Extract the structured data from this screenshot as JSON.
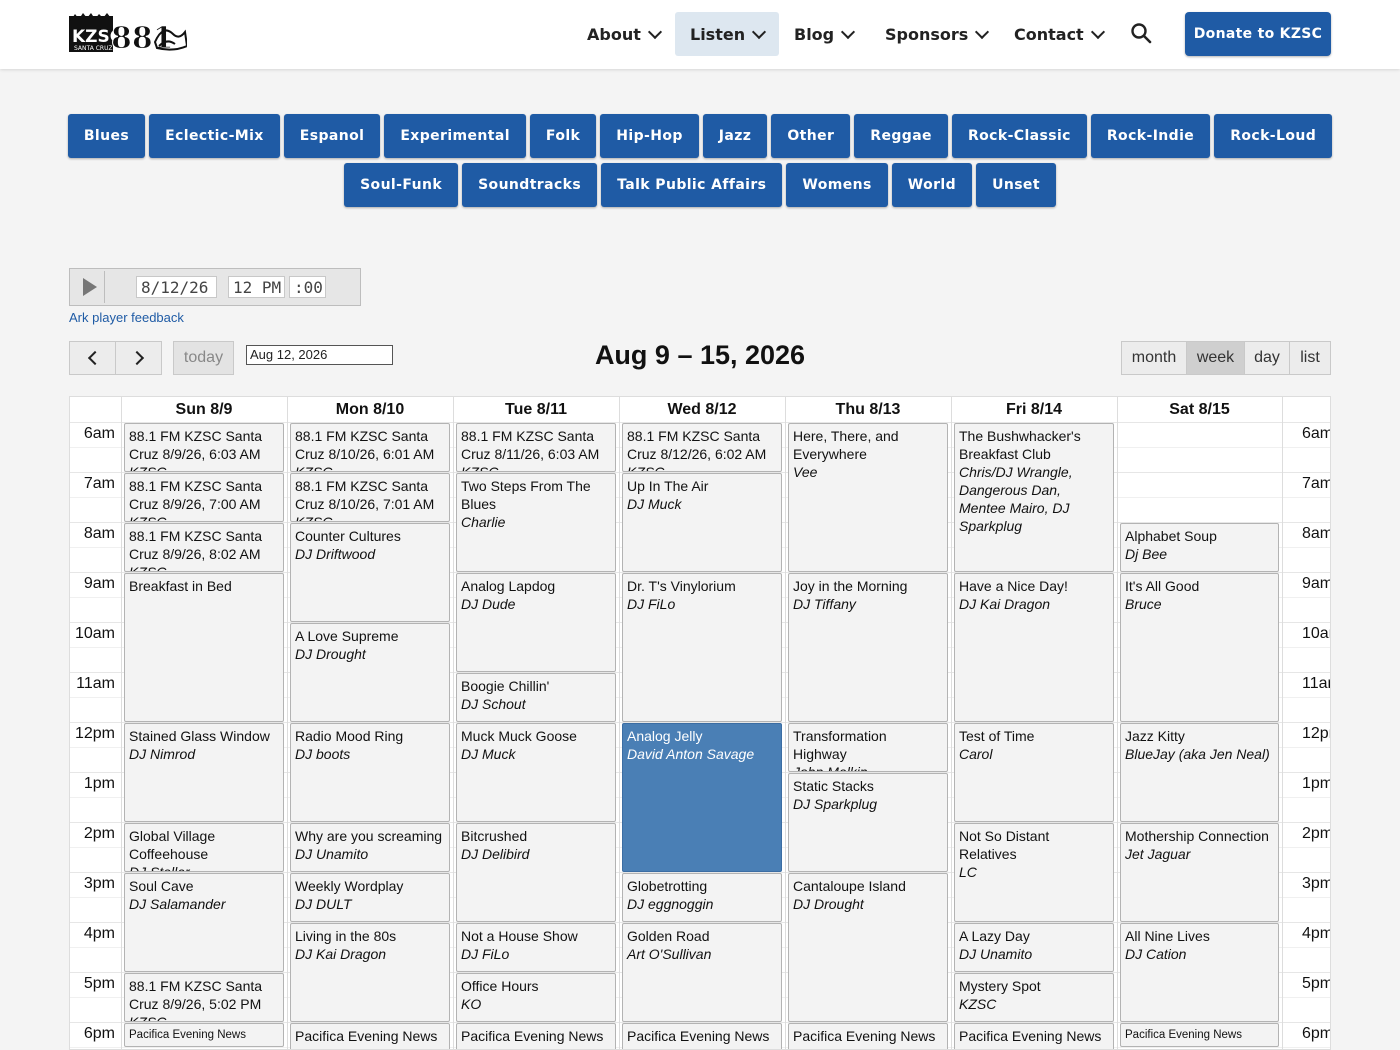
{
  "logo": {
    "alt": "KZSC 88.1 Santa Cruz"
  },
  "nav": {
    "items": [
      "About",
      "Listen",
      "Blog",
      "Sponsors",
      "Contact"
    ],
    "donate": "Donate to KZSC"
  },
  "genres_row1": [
    "Blues",
    "Eclectic-Mix",
    "Espanol",
    "Experimental",
    "Folk",
    "Hip-Hop",
    "Jazz",
    "Other",
    "Reggae",
    "Rock-Classic",
    "Rock-Indie",
    "Rock-Loud"
  ],
  "genres_row2": [
    "Soul-Funk",
    "Soundtracks",
    "Talk Public Affairs",
    "Womens",
    "World",
    "Unset"
  ],
  "player": {
    "date": "8/12/26",
    "hour": "12 PM",
    "minute": ":00",
    "feedback": "Ark player feedback"
  },
  "calendar": {
    "today_label": "today",
    "date_value": "Aug 12, 2026",
    "title": "Aug 9 – 15, 2026",
    "views": [
      "month",
      "week",
      "day",
      "list"
    ],
    "active_view": "week",
    "days": [
      "Sun 8/9",
      "Mon 8/10",
      "Tue 8/11",
      "Wed 8/12",
      "Thu 8/13",
      "Fri 8/14",
      "Sat 8/15"
    ],
    "hours": [
      "6am",
      "7am",
      "8am",
      "9am",
      "10am",
      "11am",
      "12pm",
      "1pm",
      "2pm",
      "3pm",
      "4pm",
      "5pm",
      "6pm"
    ],
    "events": [
      {
        "day": 0,
        "start": 6,
        "end": 7,
        "title": "88.1 FM KZSC Santa Cruz 8/9/26, 6:03 AM",
        "sub": "KZSC"
      },
      {
        "day": 0,
        "start": 7,
        "end": 8,
        "title": "88.1 FM KZSC Santa Cruz 8/9/26, 7:00 AM",
        "sub": "KZSC"
      },
      {
        "day": 0,
        "start": 8,
        "end": 9,
        "title": "88.1 FM KZSC Santa Cruz 8/9/26, 8:02 AM",
        "sub": "KZSC"
      },
      {
        "day": 0,
        "start": 9,
        "end": 12,
        "title": "Breakfast in Bed",
        "sub": ""
      },
      {
        "day": 0,
        "start": 12,
        "end": 14,
        "title": "Stained Glass Window",
        "sub": "DJ Nimrod"
      },
      {
        "day": 0,
        "start": 14,
        "end": 15,
        "title": "Global Village Coffeehouse",
        "sub": "DJ Stellar"
      },
      {
        "day": 0,
        "start": 15,
        "end": 17,
        "title": "Soul Cave",
        "sub": "DJ Salamander"
      },
      {
        "day": 0,
        "start": 17,
        "end": 18,
        "title": "88.1 FM KZSC Santa Cruz 8/9/26, 5:02 PM",
        "sub": "KZSC"
      },
      {
        "day": 0,
        "start": 18,
        "end": 18.5,
        "title": "Pacifica Evening News",
        "sub": "",
        "small": true
      },
      {
        "day": 1,
        "start": 6,
        "end": 7,
        "title": "88.1 FM KZSC Santa Cruz 8/10/26, 6:01 AM",
        "sub": "KZSC"
      },
      {
        "day": 1,
        "start": 7,
        "end": 8,
        "title": "88.1 FM KZSC Santa Cruz 8/10/26, 7:01 AM",
        "sub": "KZSC"
      },
      {
        "day": 1,
        "start": 8,
        "end": 10,
        "title": "Counter Cultures",
        "sub": "DJ Driftwood"
      },
      {
        "day": 1,
        "start": 10,
        "end": 12,
        "title": "A Love Supreme",
        "sub": "DJ Drought"
      },
      {
        "day": 1,
        "start": 12,
        "end": 14,
        "title": "Radio Mood Ring",
        "sub": "DJ boots"
      },
      {
        "day": 1,
        "start": 14,
        "end": 15,
        "title": "Why are you screaming",
        "sub": "DJ Unamito"
      },
      {
        "day": 1,
        "start": 15,
        "end": 16,
        "title": "Weekly Wordplay",
        "sub": "DJ DULT"
      },
      {
        "day": 1,
        "start": 16,
        "end": 18,
        "title": "Living in the 80s",
        "sub": "DJ Kai Dragon"
      },
      {
        "day": 1,
        "start": 18,
        "end": 18.6,
        "title": "Pacifica Evening News",
        "sub": ""
      },
      {
        "day": 2,
        "start": 6,
        "end": 7,
        "title": "88.1 FM KZSC Santa Cruz 8/11/26, 6:03 AM",
        "sub": "KZSC"
      },
      {
        "day": 2,
        "start": 7,
        "end": 9,
        "title": "Two Steps From The Blues",
        "sub": "Charlie"
      },
      {
        "day": 2,
        "start": 9,
        "end": 11,
        "title": "Analog Lapdog",
        "sub": "DJ Dude"
      },
      {
        "day": 2,
        "start": 11,
        "end": 12,
        "title": "Boogie Chillin'",
        "sub": "DJ Schout"
      },
      {
        "day": 2,
        "start": 12,
        "end": 14,
        "title": "Muck Muck Goose",
        "sub": "DJ Muck"
      },
      {
        "day": 2,
        "start": 14,
        "end": 16,
        "title": "Bitcrushed",
        "sub": "DJ Delibird"
      },
      {
        "day": 2,
        "start": 16,
        "end": 17,
        "title": "Not a House Show",
        "sub": "DJ FiLo"
      },
      {
        "day": 2,
        "start": 17,
        "end": 18,
        "title": "Office Hours",
        "sub": "KO"
      },
      {
        "day": 2,
        "start": 18,
        "end": 18.6,
        "title": "Pacifica Evening News",
        "sub": ""
      },
      {
        "day": 3,
        "start": 6,
        "end": 7,
        "title": "88.1 FM KZSC Santa Cruz 8/12/26, 6:02 AM",
        "sub": "KZSC"
      },
      {
        "day": 3,
        "start": 7,
        "end": 9,
        "title": "Up In The Air",
        "sub": "DJ Muck"
      },
      {
        "day": 3,
        "start": 9,
        "end": 12,
        "title": "Dr. T's Vinylorium",
        "sub": "DJ FiLo"
      },
      {
        "day": 3,
        "start": 12,
        "end": 15,
        "title": "Analog Jelly",
        "sub": "David Anton Savage",
        "hl": true
      },
      {
        "day": 3,
        "start": 15,
        "end": 16,
        "title": "Globetrotting",
        "sub": "DJ eggnoggin"
      },
      {
        "day": 3,
        "start": 16,
        "end": 18,
        "title": "Golden Road",
        "sub": "Art O'Sullivan"
      },
      {
        "day": 3,
        "start": 18,
        "end": 18.6,
        "title": "Pacifica Evening News",
        "sub": ""
      },
      {
        "day": 4,
        "start": 6,
        "end": 9,
        "title": "Here, There, and Everywhere",
        "sub": "Vee"
      },
      {
        "day": 4,
        "start": 9,
        "end": 12,
        "title": "Joy in the Morning",
        "sub": "DJ Tiffany"
      },
      {
        "day": 4,
        "start": 12,
        "end": 13,
        "title": "Transformation Highway",
        "sub": "John Malkin"
      },
      {
        "day": 4,
        "start": 13,
        "end": 15,
        "title": "Static Stacks",
        "sub": "DJ Sparkplug"
      },
      {
        "day": 4,
        "start": 15,
        "end": 18,
        "title": "Cantaloupe Island",
        "sub": "DJ Drought"
      },
      {
        "day": 4,
        "start": 18,
        "end": 18.6,
        "title": "Pacifica Evening News",
        "sub": ""
      },
      {
        "day": 5,
        "start": 6,
        "end": 9,
        "title": "The Bushwhacker's Breakfast Club",
        "sub": "Chris/DJ Wrangle, Dangerous Dan, Mentee Mairo, DJ Sparkplug"
      },
      {
        "day": 5,
        "start": 9,
        "end": 12,
        "title": "Have a Nice Day!",
        "sub": "DJ Kai Dragon"
      },
      {
        "day": 5,
        "start": 12,
        "end": 14,
        "title": "Test of Time",
        "sub": "Carol"
      },
      {
        "day": 5,
        "start": 14,
        "end": 16,
        "title": "Not So Distant Relatives",
        "sub": "LC"
      },
      {
        "day": 5,
        "start": 16,
        "end": 17,
        "title": "A Lazy Day",
        "sub": "DJ Unamito"
      },
      {
        "day": 5,
        "start": 17,
        "end": 18,
        "title": "Mystery Spot",
        "sub": "KZSC"
      },
      {
        "day": 5,
        "start": 18,
        "end": 18.6,
        "title": "Pacifica Evening News",
        "sub": ""
      },
      {
        "day": 6,
        "start": 8,
        "end": 9,
        "title": "Alphabet Soup",
        "sub": "Dj Bee"
      },
      {
        "day": 6,
        "start": 9,
        "end": 12,
        "title": "It's All Good",
        "sub": "Bruce"
      },
      {
        "day": 6,
        "start": 12,
        "end": 14,
        "title": "Jazz Kitty",
        "sub": "BlueJay (aka Jen Neal)"
      },
      {
        "day": 6,
        "start": 14,
        "end": 16,
        "title": "Mothership Connection",
        "sub": "Jet Jaguar"
      },
      {
        "day": 6,
        "start": 16,
        "end": 18,
        "title": "All Nine Lives",
        "sub": "DJ Cation"
      },
      {
        "day": 6,
        "start": 18,
        "end": 18.5,
        "title": "Pacifica Evening News",
        "sub": "",
        "small": true
      }
    ]
  },
  "colors": {
    "brand": "#1f5ba5",
    "highlight_event": "#4a7fb5"
  }
}
